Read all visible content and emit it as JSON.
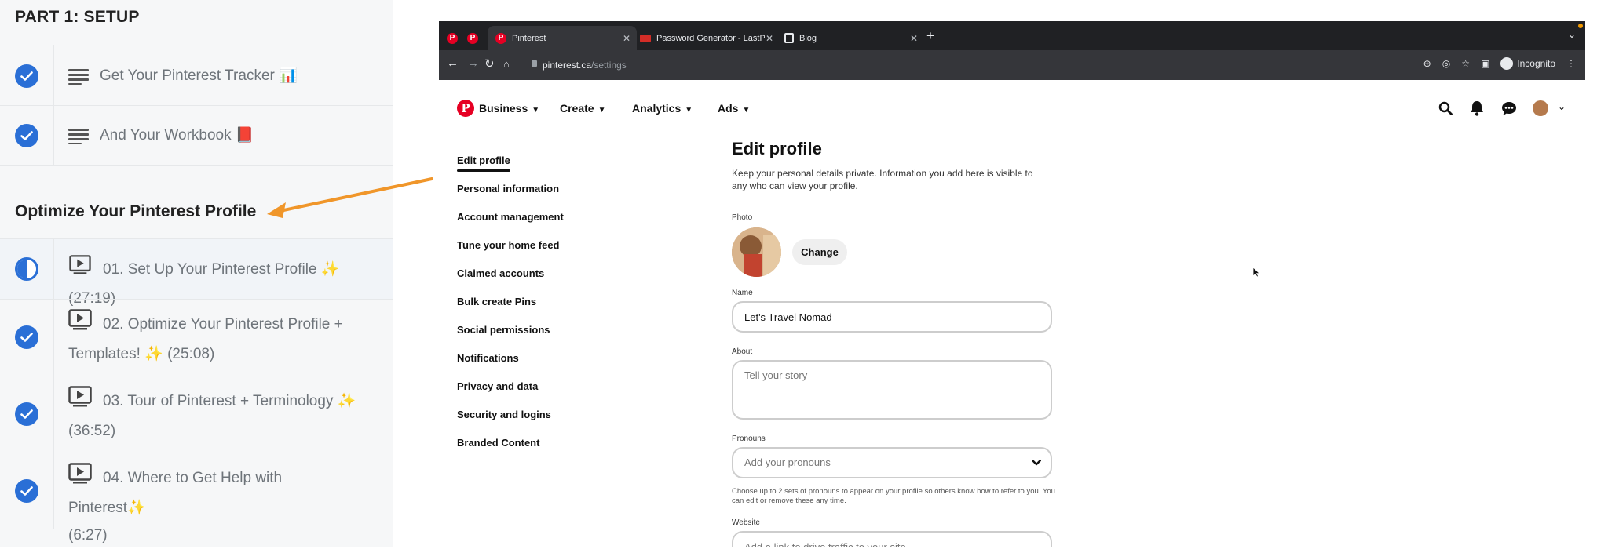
{
  "course": {
    "part_title": "PART 1: SETUP",
    "items_top": [
      {
        "label": "Get Your Pinterest Tracker",
        "emoji": "📊"
      },
      {
        "label": "And Your Workbook",
        "emoji": "📕"
      }
    ],
    "section_title": "Optimize Your Pinterest Profile",
    "lessons": [
      {
        "line1": "01. Set Up Your Pinterest Profile ✨ (27:19)",
        "line2": "",
        "progress": 0.5
      },
      {
        "line1": "02. Optimize Your Pinterest Profile +",
        "line2": "Templates! ✨ (25:08)",
        "progress": 1
      },
      {
        "line1": "03. Tour of Pinterest + Terminology ✨",
        "line2": "(36:52)",
        "progress": 1
      },
      {
        "line1": "04. Where to Get Help with Pinterest✨",
        "line2": "(6:27)",
        "progress": 1
      }
    ]
  },
  "browser": {
    "tabs": [
      {
        "label": "Pinterest",
        "active": true
      },
      {
        "label": "Password Generator - LastPass",
        "active": false
      },
      {
        "label": "Blog",
        "active": false
      }
    ],
    "new_tab": "+",
    "url_domain": "pinterest.ca",
    "url_path": "/settings",
    "incognito_label": "Incognito"
  },
  "pinterest": {
    "nav": [
      "Business",
      "Create",
      "Analytics",
      "Ads"
    ],
    "settings_nav": [
      "Edit profile",
      "Personal information",
      "Account management",
      "Tune your home feed",
      "Claimed accounts",
      "Bulk create Pins",
      "Social permissions",
      "Notifications",
      "Privacy and data",
      "Security and logins",
      "Branded Content"
    ],
    "form": {
      "title": "Edit profile",
      "description": "Keep your personal details private. Information you add here is visible to any who can view your profile.",
      "photo_label": "Photo",
      "change_label": "Change",
      "name_label": "Name",
      "name_value": "Let's Travel Nomad",
      "about_label": "About",
      "about_placeholder": "Tell your story",
      "pronouns_label": "Pronouns",
      "pronouns_placeholder": "Add your pronouns",
      "pronouns_help": "Choose up to 2 sets of pronouns to appear on your profile so others know how to refer to you. You can edit or remove these any time.",
      "website_label": "Website",
      "website_placeholder": "Add a link to drive traffic to your site"
    }
  },
  "colors": {
    "accent_blue": "#2a6fd6",
    "pinterest_red": "#e60023",
    "arrow_orange": "#f0962a"
  }
}
